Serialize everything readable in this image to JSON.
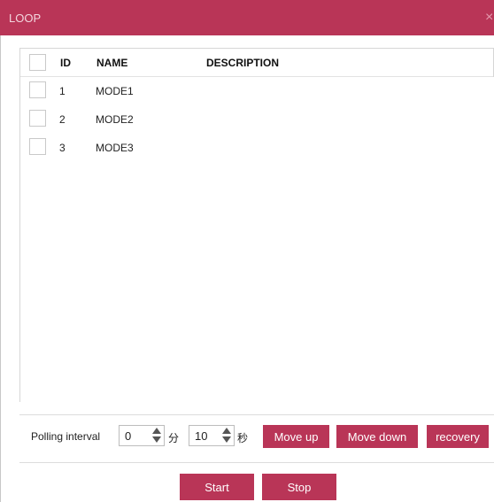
{
  "window": {
    "title": "LOOP",
    "close_glyph": "×"
  },
  "table": {
    "headers": {
      "id": "ID",
      "name": "NAME",
      "description": "DESCRIPTION"
    },
    "rows": [
      {
        "id": "1",
        "name": "MODE1",
        "description": ""
      },
      {
        "id": "2",
        "name": "MODE2",
        "description": ""
      },
      {
        "id": "3",
        "name": "MODE3",
        "description": ""
      }
    ]
  },
  "polling": {
    "label": "Polling interval",
    "minutes_value": "0",
    "minutes_unit": "分",
    "seconds_value": "10",
    "seconds_unit": "秒"
  },
  "buttons": {
    "move_up": "Move up",
    "move_down": "Move down",
    "recovery": "recovery",
    "start": "Start",
    "stop": "Stop"
  },
  "colors": {
    "accent": "#b93557"
  }
}
